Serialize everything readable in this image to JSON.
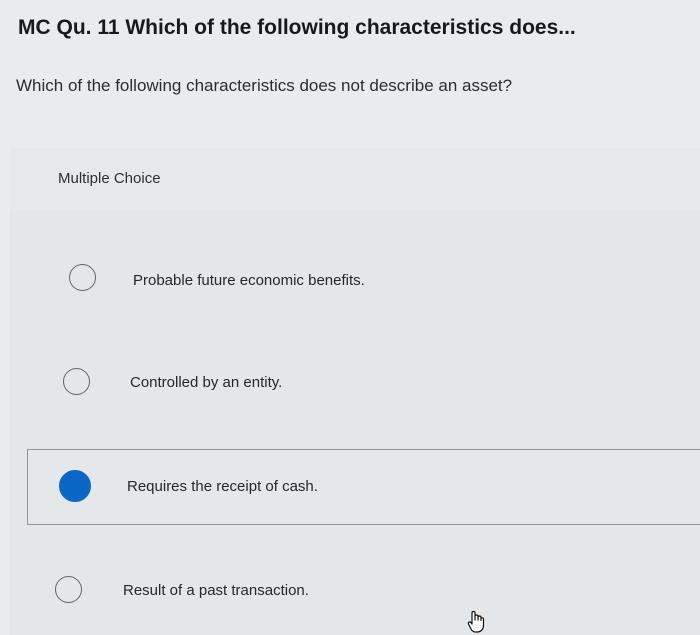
{
  "header": {
    "title": "MC Qu. 11 Which of the following characteristics does..."
  },
  "question": {
    "text": "Which of the following characteristics does not describe an asset?"
  },
  "choices": {
    "label": "Multiple Choice",
    "options": [
      {
        "text": "Probable future economic benefits.",
        "selected": false
      },
      {
        "text": "Controlled by an entity.",
        "selected": false
      },
      {
        "text": "Requires the receipt of cash.",
        "selected": true
      },
      {
        "text": "Result of a past transaction.",
        "selected": false
      }
    ]
  },
  "colors": {
    "selected_radio": "#0a67c6",
    "background": "#e9ecee"
  },
  "icons": {
    "cursor": "hand-pointer-icon"
  }
}
